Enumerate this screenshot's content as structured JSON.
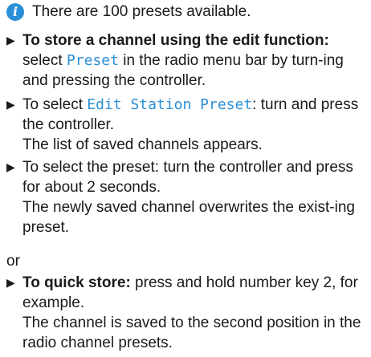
{
  "info": {
    "icon": "info-icon",
    "text": "There are 100 presets available."
  },
  "steps": [
    {
      "bold": "To store a channel using the edit function:",
      "text_pre": "select ",
      "highlight": "Preset",
      "text_post": " in the radio menu bar by turn-ing and pressing the controller."
    },
    {
      "text_pre": "To select ",
      "highlight": "Edit Station Preset",
      "text_post": ": turn and press the controller.",
      "result": "The list of saved channels appears."
    },
    {
      "text": "To select the preset: turn the controller and press for about 2 seconds.",
      "result": "The newly saved channel overwrites the exist-ing preset."
    }
  ],
  "or_text": "or",
  "quick_store": {
    "bold": "To quick store:",
    "text": " press and hold number key 2, for example.",
    "result": "The channel is saved to the second position in the radio channel presets."
  },
  "colors": {
    "accent": "#2a8fd6",
    "text": "#1a1a1a"
  }
}
